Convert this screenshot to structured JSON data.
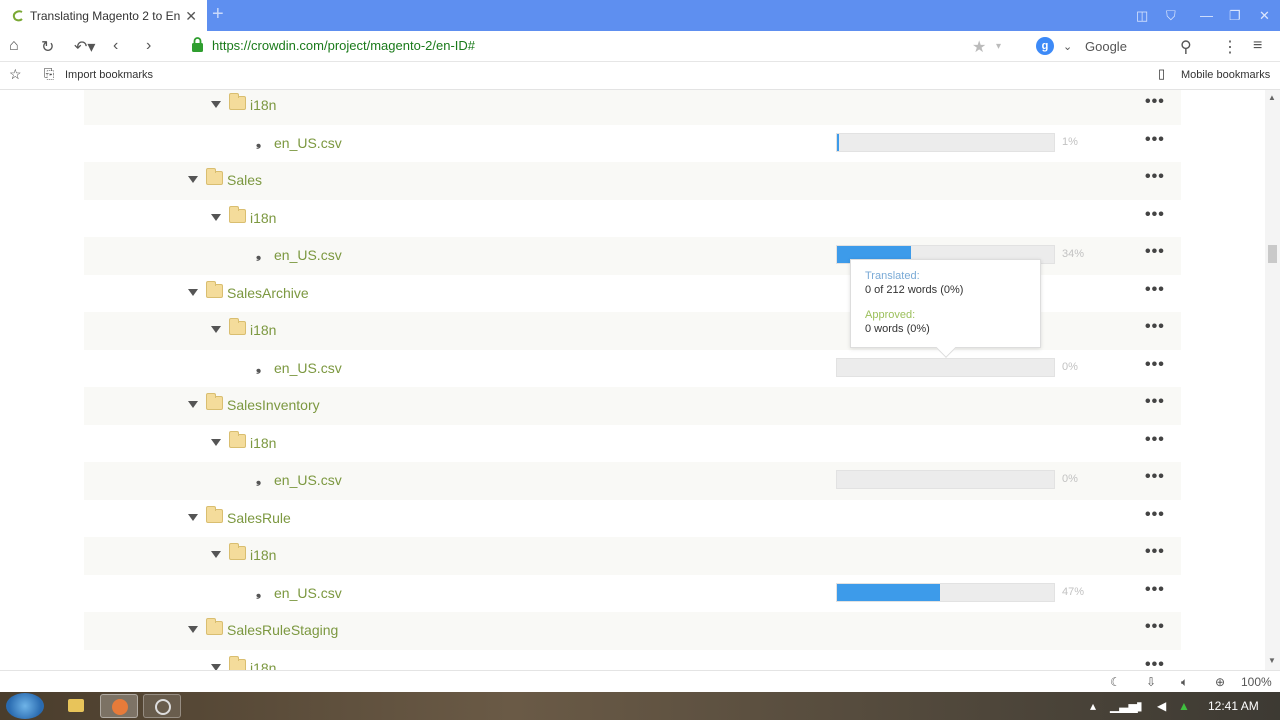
{
  "browser": {
    "tab_title": "Translating Magento 2 to Engl",
    "url": "https://crowdin.com/project/magento-2/en-ID#",
    "search_engine": "Google",
    "bookmarks": {
      "import": "Import bookmarks",
      "mobile": "Mobile bookmarks"
    }
  },
  "tree": [
    {
      "type": "folder",
      "level": 2,
      "name": "i18n",
      "shade": true
    },
    {
      "type": "file",
      "level": 3,
      "name": "en_US.csv",
      "progress": 1,
      "pct_label": "1%",
      "shade": false
    },
    {
      "type": "folder",
      "level": 1,
      "name": "Sales",
      "shade": true
    },
    {
      "type": "folder",
      "level": 2,
      "name": "i18n",
      "shade": false
    },
    {
      "type": "file",
      "level": 3,
      "name": "en_US.csv",
      "progress": 34,
      "pct_label": "34%",
      "shade": true
    },
    {
      "type": "folder",
      "level": 1,
      "name": "SalesArchive",
      "shade": false
    },
    {
      "type": "folder",
      "level": 2,
      "name": "i18n",
      "shade": true
    },
    {
      "type": "file",
      "level": 3,
      "name": "en_US.csv",
      "progress": 0,
      "pct_label": "0%",
      "shade": false
    },
    {
      "type": "folder",
      "level": 1,
      "name": "SalesInventory",
      "shade": true
    },
    {
      "type": "folder",
      "level": 2,
      "name": "i18n",
      "shade": false
    },
    {
      "type": "file",
      "level": 3,
      "name": "en_US.csv",
      "progress": 0,
      "pct_label": "0%",
      "shade": true
    },
    {
      "type": "folder",
      "level": 1,
      "name": "SalesRule",
      "shade": false
    },
    {
      "type": "folder",
      "level": 2,
      "name": "i18n",
      "shade": true
    },
    {
      "type": "file",
      "level": 3,
      "name": "en_US.csv",
      "progress": 47,
      "pct_label": "47%",
      "shade": false
    },
    {
      "type": "folder",
      "level": 1,
      "name": "SalesRuleStaging",
      "shade": true
    },
    {
      "type": "folder",
      "level": 2,
      "name": "i18n",
      "shade": false
    }
  ],
  "tooltip": {
    "translated_label": "Translated:",
    "translated_value": "0 of 212 words (0%)",
    "approved_label": "Approved:",
    "approved_value": "0 words (0%)",
    "translated_color": "#7aaad6",
    "approved_color": "#9bbf5a"
  },
  "statusbar": {
    "zoom": "100%"
  },
  "taskbar": {
    "clock": "12:41 AM"
  },
  "colors": {
    "titlebar": "#5e8ff0",
    "progress_fill": "#3d9bea",
    "folder_name": "#7c9840"
  }
}
